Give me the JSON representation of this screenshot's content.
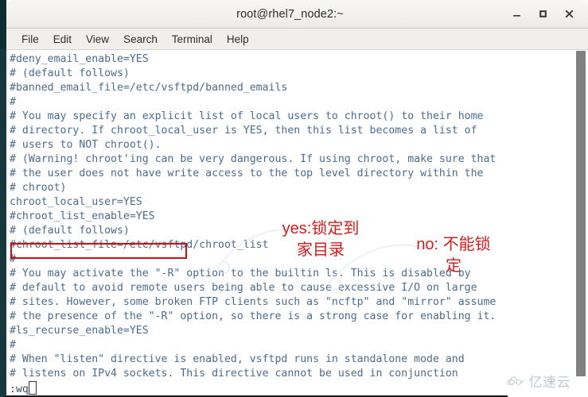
{
  "window": {
    "title": "root@rhel7_node2:~",
    "controls": [
      {
        "name": "minimize",
        "glyph": "–"
      },
      {
        "name": "maximize",
        "glyph": "□"
      },
      {
        "name": "close",
        "glyph": "✕"
      }
    ]
  },
  "menu": {
    "items": [
      "File",
      "Edit",
      "View",
      "Search",
      "Terminal",
      "Help"
    ]
  },
  "terminal": {
    "lines": [
      "#deny_email_enable=YES",
      "# (default follows)",
      "#banned_email_file=/etc/vsftpd/banned_emails",
      "#",
      "# You may specify an explicit list of local users to chroot() to their home",
      "# directory. If chroot_local_user is YES, then this list becomes a list of",
      "# users to NOT chroot().",
      "# (Warning! chroot'ing can be very dangerous. If using chroot, make sure that",
      "# the user does not have write access to the top level directory within the",
      "# chroot)",
      "chroot_local_user=YES",
      "#chroot_list_enable=YES",
      "# (default follows)",
      "#chroot_list_file=/etc/vsftpd/chroot_list",
      "#",
      "# You may activate the \"-R\" option to the builtin ls. This is disabled by",
      "# default to avoid remote users being able to cause excessive I/O on large",
      "# sites. However, some broken FTP clients such as \"ncftp\" and \"mirror\" assume",
      "# the presence of the \"-R\" option, so there is a strong case for enabling it.",
      "#ls_recurse_enable=YES",
      "#",
      "# When \"listen\" directive is enabled, vsftpd runs in standalone mode and",
      "# listens on IPv4 sockets. This directive cannot be used in conjunction"
    ],
    "command_line": ":wq",
    "highlighted_line": "chroot_local_user=YES",
    "text_color": "#4a6c91"
  },
  "annotations": {
    "color": "#d31c1c",
    "yes_note": "yes:锁定到\n家目录",
    "no_note": "no: 不能锁\n定"
  },
  "watermark": {
    "text": "亿速云"
  }
}
